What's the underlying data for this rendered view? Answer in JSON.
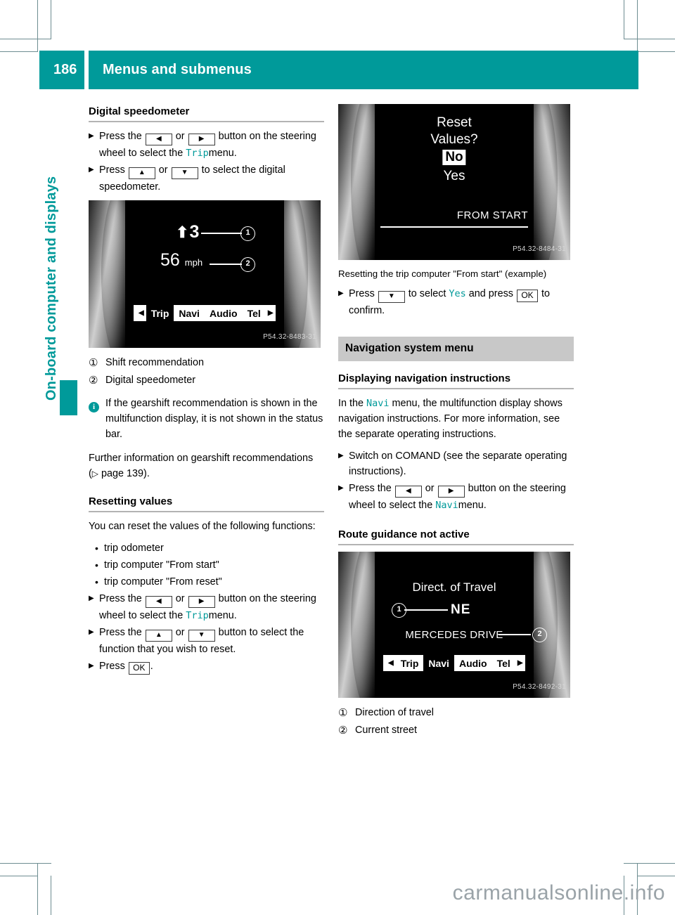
{
  "header": {
    "page_number": "186",
    "title": "Menus and submenus",
    "accent_color": "#009a9a"
  },
  "chapter_tab": {
    "label": "On-board computer and displays"
  },
  "left_column": {
    "heading_digital_speedometer": "Digital speedometer",
    "step1_a": "Press the",
    "step1_key_left": "◀",
    "step1_or": "or",
    "step1_key_right": "▶",
    "step1_b": "button on the",
    "step1_c": "steering wheel to select the",
    "step1_menu": "Trip",
    "step1_d": "menu.",
    "step2_a": "Press",
    "step2_key_up": "▲",
    "step2_or": "or",
    "step2_key_down": "▼",
    "step2_b": "to select the digital",
    "step2_c": "speedometer.",
    "figure": {
      "gear_arrow": "⬆",
      "gear_value": "3",
      "speed_value": "56",
      "speed_unit": "mph",
      "statusbar_left_arrow": "◀",
      "statusbar_items": [
        "Trip",
        "Navi",
        "Audio",
        "Tel"
      ],
      "statusbar_selected": "Trip",
      "statusbar_right_arrow": "▶",
      "callout_1": "1",
      "callout_2": "2",
      "image_code": "P54.32-8483-31"
    },
    "legend": [
      {
        "num": "①",
        "text": "Shift recommendation"
      },
      {
        "num": "②",
        "text": "Digital speedometer"
      }
    ],
    "note_icon": "i",
    "note_text": "If the gearshift recommendation is shown in the multifunction display, it is not shown in the status bar.",
    "further_info_a": "Further information on gearshift",
    "further_info_b": "recommendations (",
    "further_info_arrow": "▷",
    "further_info_page": " page 139).",
    "heading_resetting_values": "Resetting values",
    "reset_intro": "You can reset the values of the following functions:",
    "reset_bullets": [
      "trip odometer",
      "trip computer \"From start\"",
      "trip computer \"From reset\""
    ],
    "step3_a": "Press the",
    "step3_b": "button on the",
    "step3_c": "steering wheel to select the",
    "step3_menu": "Trip",
    "step3_d": "menu.",
    "step4_a": "Press the",
    "step4_b": "button to select the",
    "step4_c": "function that you wish to reset.",
    "step5_a": "Press",
    "step5_ok": "OK",
    "step5_b": "."
  },
  "right_column": {
    "figure_reset": {
      "line1": "Reset",
      "line2": "Values?",
      "option_no": "No",
      "option_yes": "Yes",
      "selected_option": "No",
      "footer_label": "FROM START",
      "image_code": "P54.32-8484-31"
    },
    "caption_reset": "Resetting the trip computer \"From start\" (example)",
    "step_reset_a": "Press",
    "step_reset_key": "▼",
    "step_reset_b": "to select",
    "step_reset_yes": "Yes",
    "step_reset_c": "and press",
    "step_reset_ok": "OK",
    "step_reset_d": "to confirm.",
    "section_nav": "Navigation system menu",
    "heading_displaying": "Displaying navigation instructions",
    "nav_para_a": "In the",
    "nav_para_menu": "Navi",
    "nav_para_b": "menu, the multifunction display shows navigation instructions. For more information, see the separate operating instructions.",
    "step_comand_a": "Switch on COMAND (see the separate",
    "step_comand_b": "operating instructions).",
    "step_navi_a": "Press the",
    "step_navi_b": "button on the",
    "step_navi_c": "steering wheel to select the",
    "step_navi_menu": "Navi",
    "step_navi_d": "menu.",
    "heading_route": "Route guidance not active",
    "figure_nav": {
      "title": "Direct. of Travel",
      "direction": "NE",
      "street": "MERCEDES DRIVE",
      "statusbar_left_arrow": "◀",
      "statusbar_items": [
        "Trip",
        "Navi",
        "Audio",
        "Tel"
      ],
      "statusbar_selected": "Navi",
      "statusbar_right_arrow": "▶",
      "callout_1": "1",
      "callout_2": "2",
      "image_code": "P54.32-8492-31"
    },
    "legend": [
      {
        "num": "①",
        "text": "Direction of travel"
      },
      {
        "num": "②",
        "text": "Current street"
      }
    ]
  },
  "watermark": "carmanualsonline.info",
  "markers": {
    "step_arrow": "▶",
    "bullet": "•"
  }
}
